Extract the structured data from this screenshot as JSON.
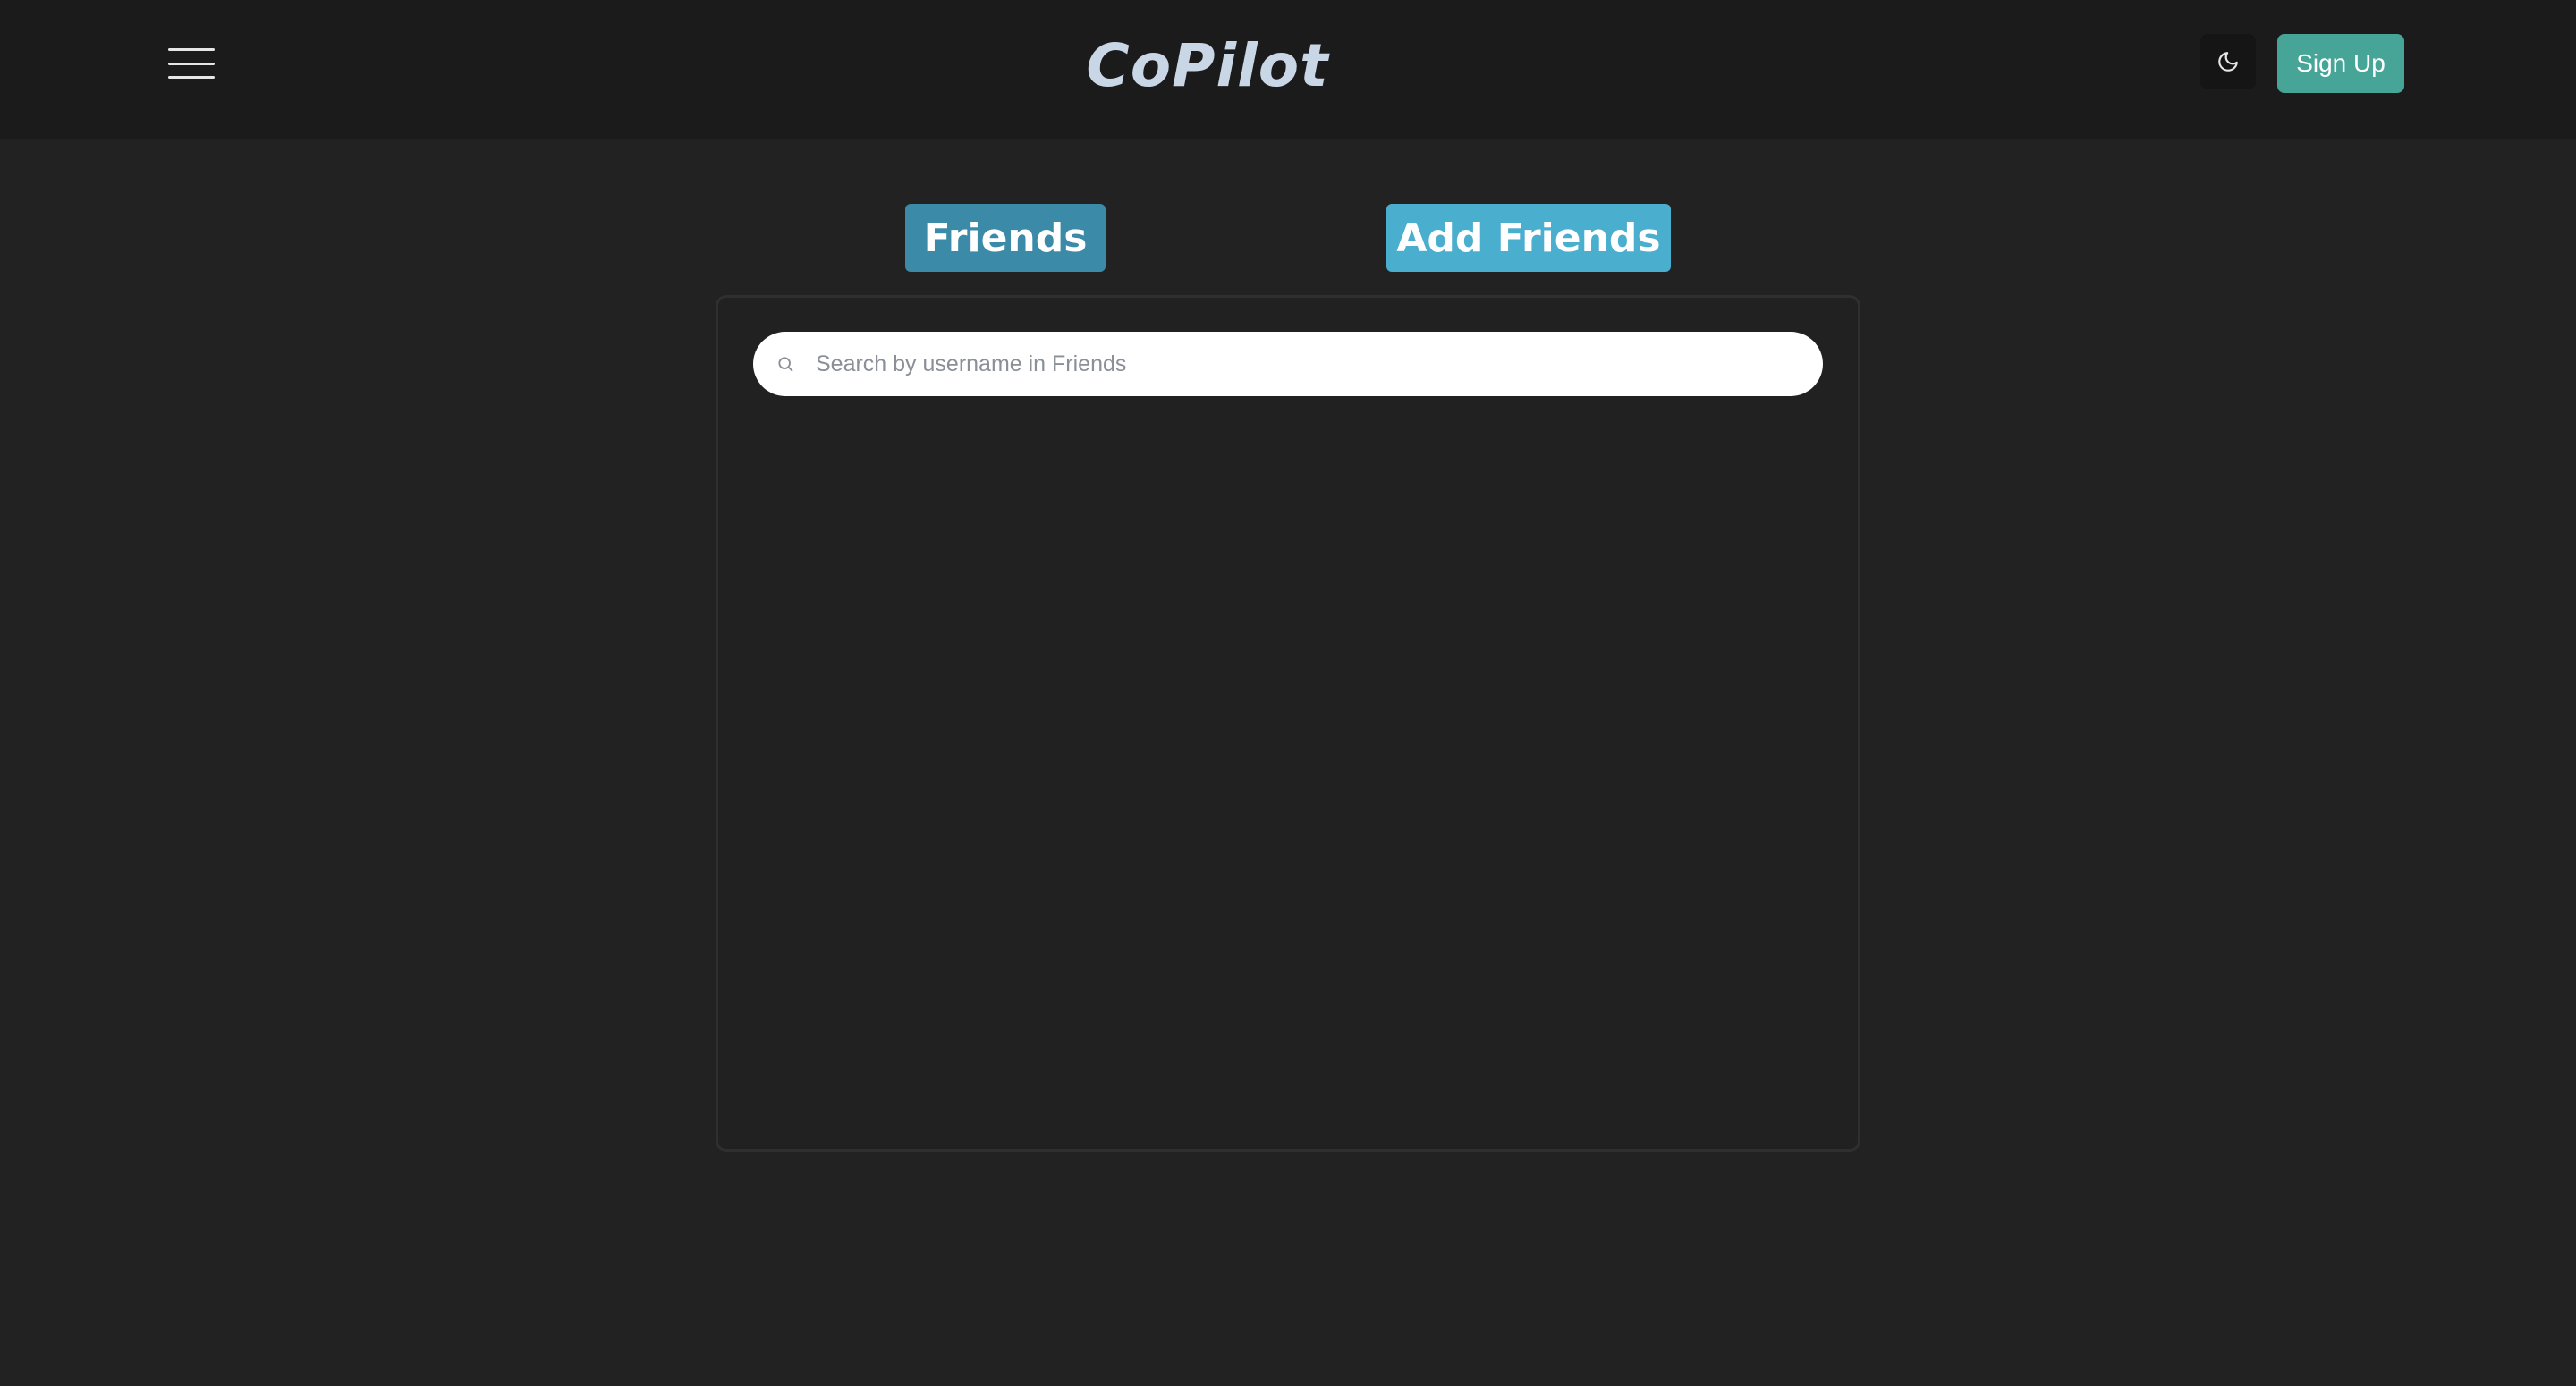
{
  "header": {
    "brand": "CoPilot",
    "signup_label": "Sign Up",
    "menu_icon": "hamburger-menu-icon",
    "theme_icon": "moon-icon"
  },
  "tabs": [
    {
      "label": "Friends",
      "active": true
    },
    {
      "label": "Add Friends",
      "active": false
    }
  ],
  "search": {
    "placeholder": "Search by username in Friends",
    "value": "",
    "icon": "search-icon"
  },
  "colors": {
    "accent": "#47a597",
    "tab_active": "#3a8aa8",
    "tab_inactive": "#4aaecf",
    "header_bg": "#1b1b1b",
    "page_bg": "#222222",
    "brand": "#c9d6e6"
  }
}
